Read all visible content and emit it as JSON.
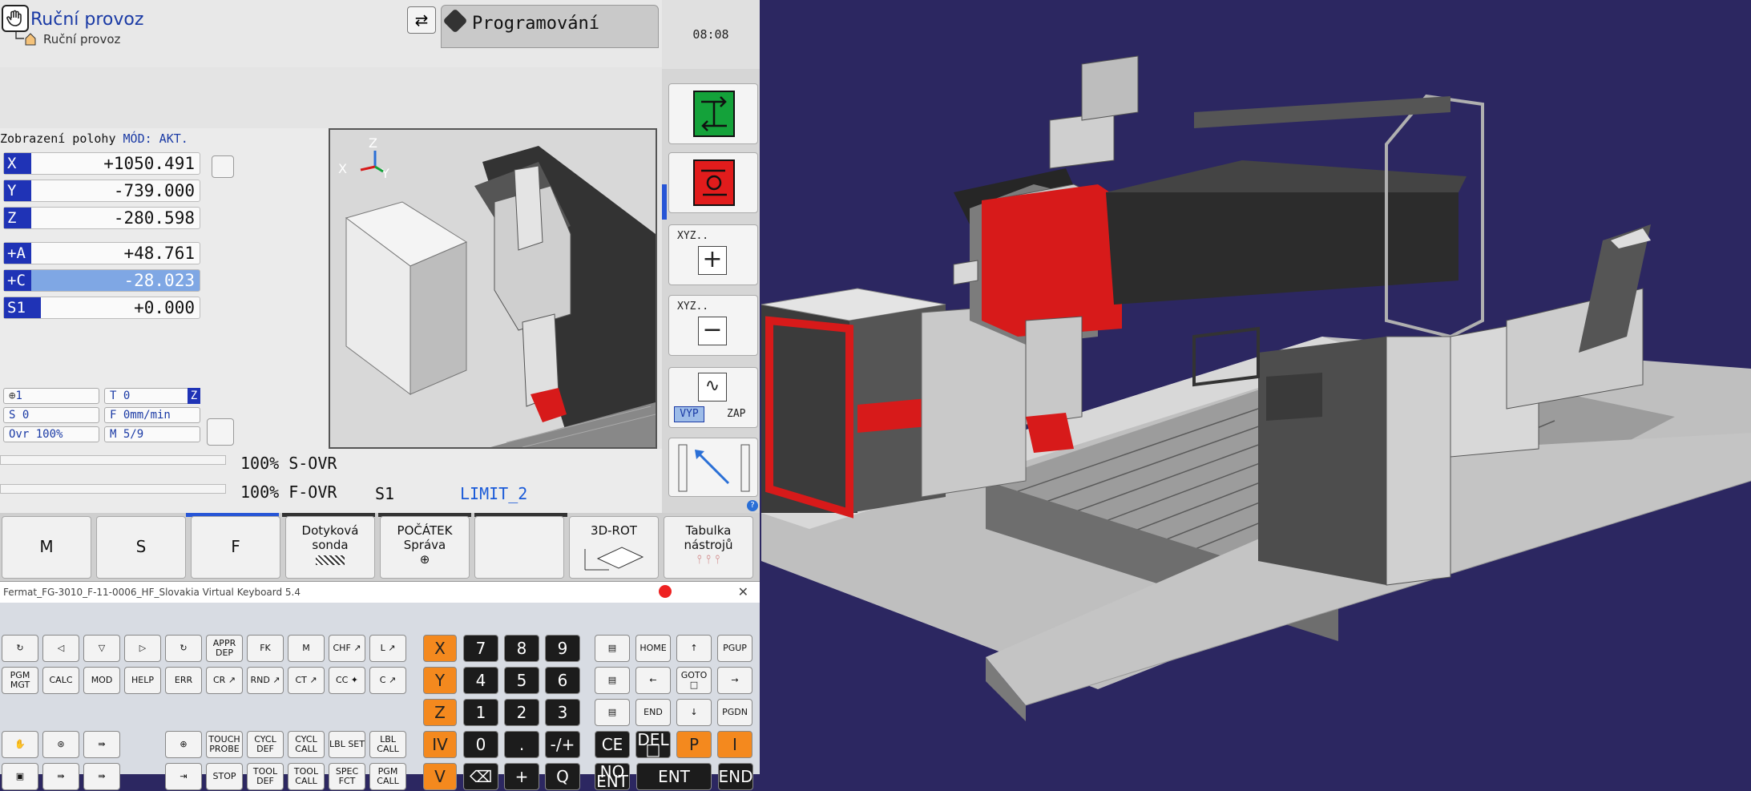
{
  "header": {
    "mode_title": "Ruční provoz",
    "mode_subtitle": "Ruční provoz",
    "prog_tab": "Programování",
    "clock": "08:08"
  },
  "position": {
    "title": "Zobrazení polohy",
    "mode": "MÓD: AKT.",
    "axes": [
      {
        "name": "X",
        "value": "+1050.491"
      },
      {
        "name": "Y",
        "value": "-739.000"
      },
      {
        "name": "Z",
        "value": "-280.598"
      },
      {
        "name": "+A",
        "value": "+48.761"
      },
      {
        "name": "+C",
        "value": "-28.023"
      },
      {
        "name": "S1",
        "value": "+0.000"
      }
    ]
  },
  "status": {
    "tool_icon": "1",
    "tool": "T 0",
    "tool_axis": "Z",
    "spindle": "S 0",
    "feed": "F 0mm/min",
    "override": "Ovr 100%",
    "m_func": "M 5/9"
  },
  "overrides": {
    "s_ovr": "100% S-OVR",
    "f_ovr": "100% F-OVR",
    "s1": "S1",
    "limit": "LIMIT_2"
  },
  "side": {
    "xyz_plus": "XYZ..",
    "xyz_minus": "XYZ..",
    "vyp": "VYP",
    "zap": "ZAP"
  },
  "softkeys": [
    {
      "line1": "M",
      "line2": ""
    },
    {
      "line1": "S",
      "line2": ""
    },
    {
      "line1": "F",
      "line2": ""
    },
    {
      "line1": "Dotyková",
      "line2": "sonda"
    },
    {
      "line1": "POČÁTEK",
      "line2": "Správa"
    },
    {
      "line1": "",
      "line2": ""
    },
    {
      "line1": "3D-ROT",
      "line2": ""
    },
    {
      "line1": "Tabulka",
      "line2": "nástrojů"
    }
  ],
  "keyboard": {
    "title": "Fermat_FG-3010_F-11-0006_HF_Slovakia Virtual Keyboard 5.4",
    "close": "✕",
    "left": [
      [
        "↻",
        "◁",
        "▽",
        "▷",
        "↻",
        "APPR DEP",
        "FK",
        "M",
        "CHF ↗",
        "L ↗"
      ],
      [
        "PGM MGT",
        "CALC",
        "MOD",
        "HELP",
        "ERR",
        "CR ↗",
        "RND ↗",
        "CT ↗",
        "CC ✦",
        "C ↗"
      ],
      [
        "",
        "",
        "",
        "",
        "",
        "",
        "",
        "",
        "",
        ""
      ],
      [
        "✋",
        "⊛",
        "⇛",
        "",
        "⊕",
        "TOUCH PROBE",
        "CYCL DEF",
        "CYCL CALL",
        "LBL SET",
        "LBL CALL"
      ],
      [
        "▣",
        "⇛",
        "⇛",
        "",
        "⇥",
        "STOP",
        "TOOL DEF",
        "TOOL CALL",
        "SPEC FCT",
        "PGM CALL"
      ]
    ],
    "axes": [
      "X",
      "Y",
      "Z",
      "IV",
      "V"
    ],
    "numpad": [
      [
        "7",
        "8",
        "9"
      ],
      [
        "4",
        "5",
        "6"
      ],
      [
        "1",
        "2",
        "3"
      ],
      [
        "0",
        ".",
        "-/+"
      ],
      [
        "⌫",
        "+",
        "Q"
      ]
    ],
    "nav": [
      [
        "▤",
        "HOME",
        "↑",
        "PGUP"
      ],
      [
        "▤",
        "←",
        "GOTO □",
        "→"
      ],
      [
        "▤",
        "END",
        "↓",
        "PGDN"
      ],
      [
        "CE",
        "DEL □",
        "P",
        "I"
      ],
      [
        "NO ENT",
        "ENT",
        "END"
      ]
    ]
  }
}
